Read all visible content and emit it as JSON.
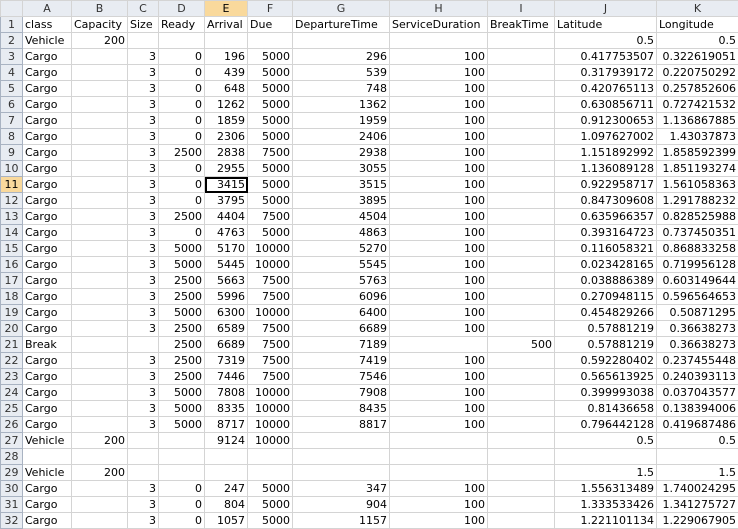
{
  "columns": [
    "A",
    "B",
    "C",
    "D",
    "E",
    "F",
    "G",
    "H",
    "I",
    "J",
    "K"
  ],
  "selected_column": "E",
  "selected_row": "11",
  "active_cell": {
    "row": "11",
    "col": "E"
  },
  "rows": [
    {
      "n": "1",
      "c": [
        "class",
        "Capacity",
        "Size",
        "Ready",
        "Arrival",
        "Due",
        "DepartureTime",
        "ServiceDuration",
        "BreakTime",
        "Latitude",
        "Longitude"
      ]
    },
    {
      "n": "2",
      "c": [
        "Vehicle",
        "200",
        "",
        "",
        "",
        "",
        "",
        "",
        "",
        "0.5",
        "0.5"
      ]
    },
    {
      "n": "3",
      "c": [
        "Cargo",
        "",
        "3",
        "0",
        "196",
        "5000",
        "296",
        "100",
        "",
        "0.417753507",
        "0.322619051"
      ]
    },
    {
      "n": "4",
      "c": [
        "Cargo",
        "",
        "3",
        "0",
        "439",
        "5000",
        "539",
        "100",
        "",
        "0.317939172",
        "0.220750292"
      ]
    },
    {
      "n": "5",
      "c": [
        "Cargo",
        "",
        "3",
        "0",
        "648",
        "5000",
        "748",
        "100",
        "",
        "0.420765113",
        "0.257852606"
      ]
    },
    {
      "n": "6",
      "c": [
        "Cargo",
        "",
        "3",
        "0",
        "1262",
        "5000",
        "1362",
        "100",
        "",
        "0.630856711",
        "0.727421532"
      ]
    },
    {
      "n": "7",
      "c": [
        "Cargo",
        "",
        "3",
        "0",
        "1859",
        "5000",
        "1959",
        "100",
        "",
        "0.912300653",
        "1.136867885"
      ]
    },
    {
      "n": "8",
      "c": [
        "Cargo",
        "",
        "3",
        "0",
        "2306",
        "5000",
        "2406",
        "100",
        "",
        "1.097627002",
        "1.43037873"
      ]
    },
    {
      "n": "9",
      "c": [
        "Cargo",
        "",
        "3",
        "2500",
        "2838",
        "7500",
        "2938",
        "100",
        "",
        "1.151892992",
        "1.858592399"
      ]
    },
    {
      "n": "10",
      "c": [
        "Cargo",
        "",
        "3",
        "0",
        "2955",
        "5000",
        "3055",
        "100",
        "",
        "1.136089128",
        "1.851193274"
      ]
    },
    {
      "n": "11",
      "c": [
        "Cargo",
        "",
        "3",
        "0",
        "3415",
        "5000",
        "3515",
        "100",
        "",
        "0.922958717",
        "1.561058363"
      ]
    },
    {
      "n": "12",
      "c": [
        "Cargo",
        "",
        "3",
        "0",
        "3795",
        "5000",
        "3895",
        "100",
        "",
        "0.847309608",
        "1.291788232"
      ]
    },
    {
      "n": "13",
      "c": [
        "Cargo",
        "",
        "3",
        "2500",
        "4404",
        "7500",
        "4504",
        "100",
        "",
        "0.635966357",
        "0.828525988"
      ]
    },
    {
      "n": "14",
      "c": [
        "Cargo",
        "",
        "3",
        "0",
        "4763",
        "5000",
        "4863",
        "100",
        "",
        "0.393164723",
        "0.737450351"
      ]
    },
    {
      "n": "15",
      "c": [
        "Cargo",
        "",
        "3",
        "5000",
        "5170",
        "10000",
        "5270",
        "100",
        "",
        "0.116058321",
        "0.868833258"
      ]
    },
    {
      "n": "16",
      "c": [
        "Cargo",
        "",
        "3",
        "5000",
        "5445",
        "10000",
        "5545",
        "100",
        "",
        "0.023428165",
        "0.719956128"
      ]
    },
    {
      "n": "17",
      "c": [
        "Cargo",
        "",
        "3",
        "2500",
        "5663",
        "7500",
        "5763",
        "100",
        "",
        "0.038886389",
        "0.603149644"
      ]
    },
    {
      "n": "18",
      "c": [
        "Cargo",
        "",
        "3",
        "2500",
        "5996",
        "7500",
        "6096",
        "100",
        "",
        "0.270948115",
        "0.596564653"
      ]
    },
    {
      "n": "19",
      "c": [
        "Cargo",
        "",
        "3",
        "5000",
        "6300",
        "10000",
        "6400",
        "100",
        "",
        "0.454829266",
        "0.50871295"
      ]
    },
    {
      "n": "20",
      "c": [
        "Cargo",
        "",
        "3",
        "2500",
        "6589",
        "7500",
        "6689",
        "100",
        "",
        "0.57881219",
        "0.36638273"
      ]
    },
    {
      "n": "21",
      "c": [
        "Break",
        "",
        "",
        "2500",
        "6689",
        "7500",
        "7189",
        "",
        "500",
        "0.57881219",
        "0.36638273"
      ]
    },
    {
      "n": "22",
      "c": [
        "Cargo",
        "",
        "3",
        "2500",
        "7319",
        "7500",
        "7419",
        "100",
        "",
        "0.592280402",
        "0.237455448"
      ]
    },
    {
      "n": "23",
      "c": [
        "Cargo",
        "",
        "3",
        "2500",
        "7446",
        "7500",
        "7546",
        "100",
        "",
        "0.565613925",
        "0.240393113"
      ]
    },
    {
      "n": "24",
      "c": [
        "Cargo",
        "",
        "3",
        "5000",
        "7808",
        "10000",
        "7908",
        "100",
        "",
        "0.399993038",
        "0.037043577"
      ]
    },
    {
      "n": "25",
      "c": [
        "Cargo",
        "",
        "3",
        "5000",
        "8335",
        "10000",
        "8435",
        "100",
        "",
        "0.81436658",
        "0.138394006"
      ]
    },
    {
      "n": "26",
      "c": [
        "Cargo",
        "",
        "3",
        "5000",
        "8717",
        "10000",
        "8817",
        "100",
        "",
        "0.796442128",
        "0.419687486"
      ]
    },
    {
      "n": "27",
      "c": [
        "Vehicle",
        "200",
        "",
        "",
        "9124",
        "10000",
        "",
        "",
        "",
        "0.5",
        "0.5"
      ]
    },
    {
      "n": "28",
      "c": [
        "",
        "",
        "",
        "",
        "",
        "",
        "",
        "",
        "",
        "",
        ""
      ]
    },
    {
      "n": "29",
      "c": [
        "Vehicle",
        "200",
        "",
        "",
        "",
        "",
        "",
        "",
        "",
        "1.5",
        "1.5"
      ]
    },
    {
      "n": "30",
      "c": [
        "Cargo",
        "",
        "3",
        "0",
        "247",
        "5000",
        "347",
        "100",
        "",
        "1.556313489",
        "1.740024295"
      ]
    },
    {
      "n": "31",
      "c": [
        "Cargo",
        "",
        "3",
        "0",
        "804",
        "5000",
        "904",
        "100",
        "",
        "1.333533426",
        "1.341275727"
      ]
    },
    {
      "n": "32",
      "c": [
        "Cargo",
        "",
        "3",
        "0",
        "1057",
        "5000",
        "1157",
        "100",
        "",
        "1.221101134",
        "1.229067905"
      ]
    }
  ]
}
